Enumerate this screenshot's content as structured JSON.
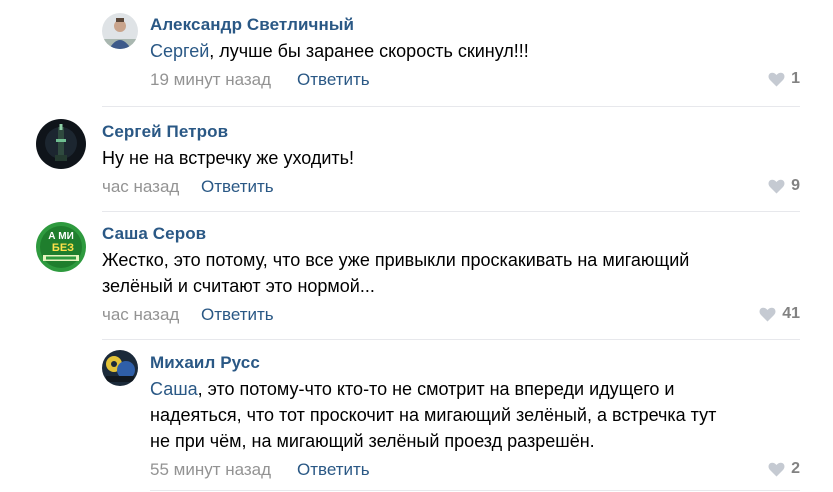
{
  "comments": [
    {
      "author": "Александр Светличный",
      "mention": "Сергей",
      "text": ", лучше бы заранее скорость скинул!!!",
      "time": "19 минут назад",
      "reply_label": "Ответить",
      "likes": "1"
    },
    {
      "author": "Сергей Петров",
      "text": "Ну не на встречку же уходить!",
      "time": "час назад",
      "reply_label": "Ответить",
      "likes": "9"
    },
    {
      "author": "Саша Серов",
      "text_line1": "Жестко, это потому, что все уже привыкли проскакивать на мигающий",
      "text_line2": "зелёный и считают это нормой...",
      "time": "час назад",
      "reply_label": "Ответить",
      "likes": "41",
      "avatar_text_top": "А МИ",
      "avatar_text_mid": "БЕЗ"
    },
    {
      "author": "Михаил Русс",
      "mention": "Саша",
      "text_line1": ", это потому-что кто-то не смотрит на впереди идущего и",
      "text_line2": "надеяться, что тот проскочит на мигающий зелёный, а встречка тут",
      "text_line3": "не при чём, на мигающий зелёный проезд разрешён.",
      "time": "55 минут назад",
      "reply_label": "Ответить",
      "likes": "2"
    }
  ],
  "colors": {
    "link": "#2a5885",
    "meta": "#939393",
    "separator": "#e7e8ec",
    "heart": "#c5cad2"
  },
  "icons": [
    "heart-icon"
  ]
}
